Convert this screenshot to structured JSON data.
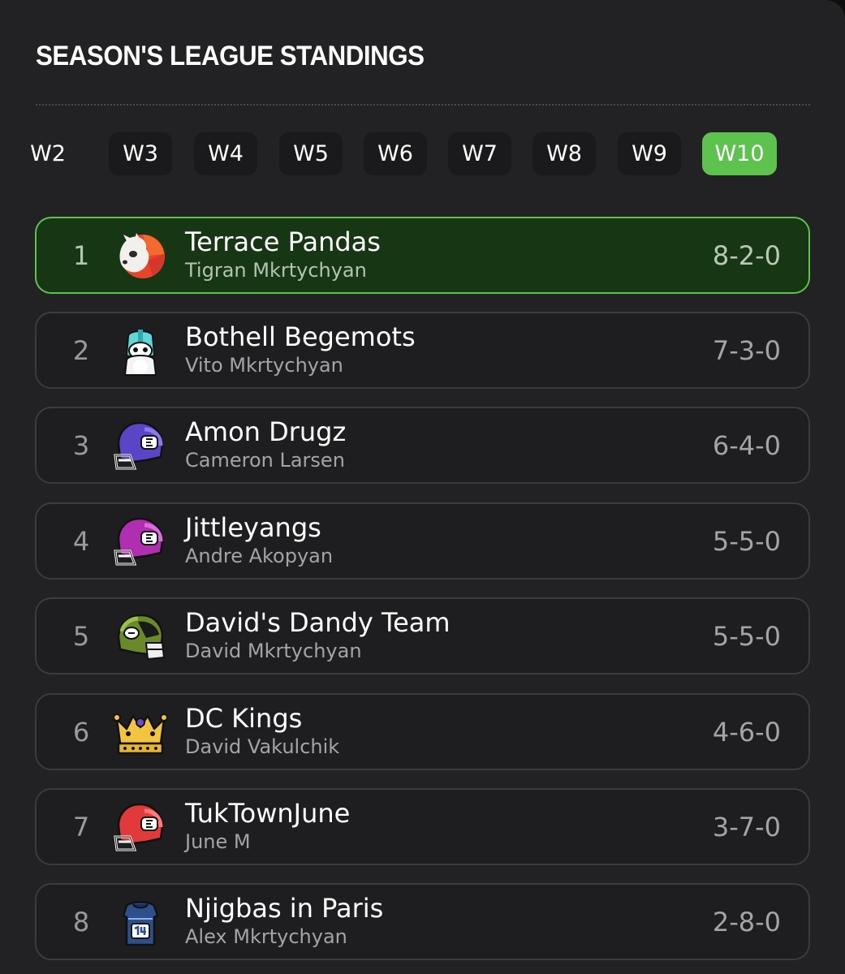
{
  "page": {
    "title": "SEASON'S LEAGUE STANDINGS"
  },
  "weeks": {
    "items": [
      "W2",
      "W3",
      "W4",
      "W5",
      "W6",
      "W7",
      "W8",
      "W9",
      "W10"
    ],
    "selected": "W10"
  },
  "colors": {
    "accent": "#5ec24e",
    "background": "#222224",
    "highlight_row": "#163614"
  },
  "standings": [
    {
      "rank": "1",
      "team": "Terrace Pandas",
      "owner": "Tigran Mkrtychyan",
      "record": "8-2-0",
      "logo": "panda-logo-icon"
    },
    {
      "rank": "2",
      "team": "Bothell Begemots",
      "owner": "Vito Mkrtychyan",
      "record": "7-3-0",
      "logo": "penguin-helmet-logo-icon"
    },
    {
      "rank": "3",
      "team": "Amon Drugz",
      "owner": "Cameron Larsen",
      "record": "6-4-0",
      "logo": "purple-helmet-logo-icon"
    },
    {
      "rank": "4",
      "team": "Jittleyangs",
      "owner": "Andre Akopyan",
      "record": "5-5-0",
      "logo": "magenta-helmet-logo-icon"
    },
    {
      "rank": "5",
      "team": "David's Dandy Team",
      "owner": "David Mkrtychyan",
      "record": "5-5-0",
      "logo": "green-helmet-logo-icon"
    },
    {
      "rank": "6",
      "team": "DC Kings",
      "owner": "David Vakulchik",
      "record": "4-6-0",
      "logo": "crown-logo-icon"
    },
    {
      "rank": "7",
      "team": "TukTownJune",
      "owner": "June M",
      "record": "3-7-0",
      "logo": "red-helmet-logo-icon"
    },
    {
      "rank": "8",
      "team": "Njigbas in Paris",
      "owner": "Alex Mkrtychyan",
      "record": "2-8-0",
      "logo": "jersey-logo-icon"
    }
  ]
}
